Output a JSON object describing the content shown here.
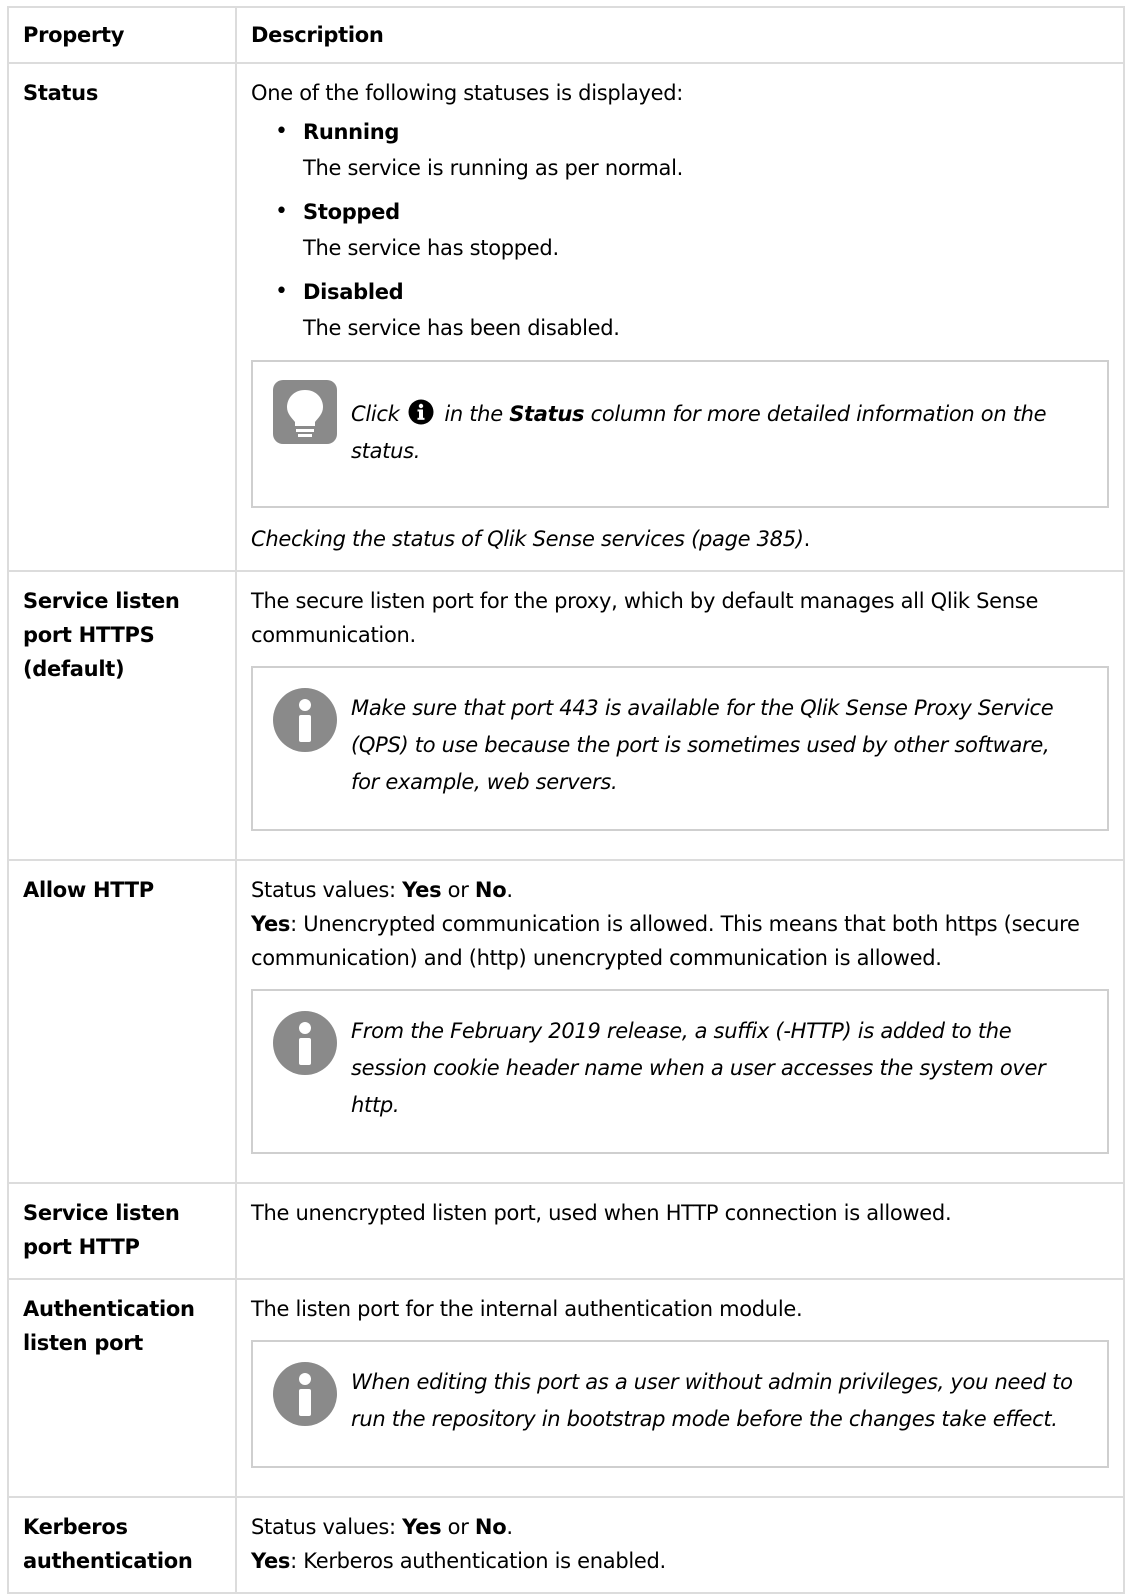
{
  "table": {
    "headers": {
      "property": "Property",
      "description": "Description"
    },
    "status": {
      "property": "Status",
      "intro": "One of the following statuses is displayed:",
      "items": [
        {
          "name": "Running",
          "desc": "The service is running as per normal."
        },
        {
          "name": "Stopped",
          "desc": "The service has stopped."
        },
        {
          "name": "Disabled",
          "desc": "The service has been disabled."
        }
      ],
      "tip": {
        "before": "Click",
        "middle": "in the",
        "bold": "Status",
        "after": "column for more detailed information on the status."
      },
      "xref": "Checking the status of Qlik Sense services (page 385)",
      "xref_end": "."
    },
    "https_port": {
      "property": "Service listen port HTTPS (default)",
      "text": "The secure listen port for the proxy, which by default manages all Qlik Sense communication.",
      "note": "Make sure that port 443 is available for the Qlik Sense Proxy Service (QPS) to use because the port is sometimes used by other software, for example, web servers."
    },
    "allow_http": {
      "property": "Allow HTTP",
      "values_prefix": "Status values: ",
      "yes": "Yes",
      "or": " or ",
      "no": "No",
      "period": ".",
      "yes_label": "Yes",
      "yes_text": ": Unencrypted communication is allowed. This means that both https (secure communication) and (http) unencrypted communication is allowed.",
      "note": "From the February 2019 release, a suffix (-HTTP) is added to the session cookie header name when a user accesses the system over http."
    },
    "http_port": {
      "property": "Service listen port HTTP",
      "text": "The unencrypted listen port, used when HTTP connection is allowed."
    },
    "auth_port": {
      "property": "Authentication listen port",
      "text": "The listen port for the internal authentication module.",
      "note": "When editing this port as a user without admin privileges, you need to run the repository in bootstrap mode before the changes take effect."
    },
    "kerberos": {
      "property": "Kerberos authentication",
      "values_prefix": "Status values: ",
      "yes": "Yes",
      "or": " or ",
      "no": "No",
      "period": ".",
      "yes_label": "Yes",
      "yes_text": ": Kerberos authentication is enabled."
    }
  },
  "icons": {
    "tip": "lightbulb-icon",
    "note": "info-icon",
    "inline": "info-circle-icon"
  },
  "colors": {
    "border": "#dcdcdc",
    "icon_gray": "#8a8a8a"
  }
}
